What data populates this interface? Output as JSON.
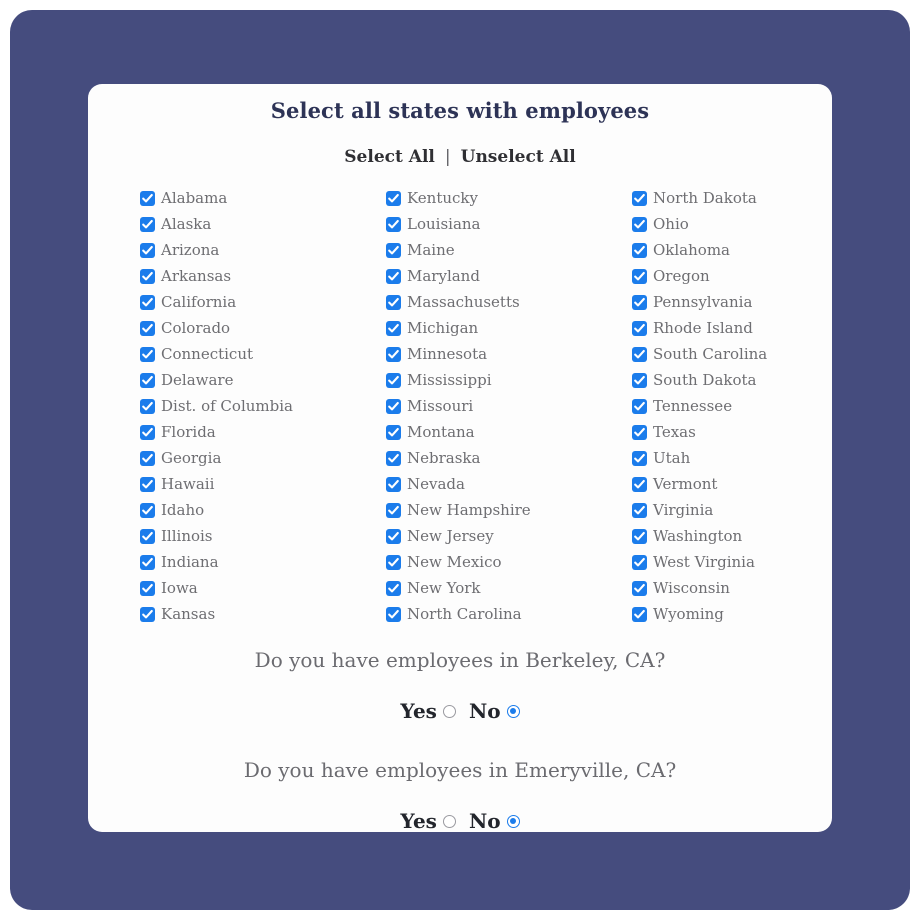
{
  "theme": {
    "page_background": "#ffffff",
    "viewport_background": "#454c7e",
    "card_background": "#fdfdfd",
    "title_color": "#2d3356",
    "label_color": "#6e6e72",
    "accent_blue": "#1b7ceb"
  },
  "form": {
    "title": "Select all states with employees",
    "bulk": {
      "select_all_label": "Select All",
      "separator": "|",
      "unselect_all_label": "Unselect All"
    },
    "columns": [
      {
        "items": [
          {
            "label": "Alabama",
            "checked": true
          },
          {
            "label": "Alaska",
            "checked": true
          },
          {
            "label": "Arizona",
            "checked": true
          },
          {
            "label": "Arkansas",
            "checked": true
          },
          {
            "label": "California",
            "checked": true
          },
          {
            "label": "Colorado",
            "checked": true
          },
          {
            "label": "Connecticut",
            "checked": true
          },
          {
            "label": "Delaware",
            "checked": true
          },
          {
            "label": "Dist. of Columbia",
            "checked": true
          },
          {
            "label": "Florida",
            "checked": true
          },
          {
            "label": "Georgia",
            "checked": true
          },
          {
            "label": "Hawaii",
            "checked": true
          },
          {
            "label": "Idaho",
            "checked": true
          },
          {
            "label": "Illinois",
            "checked": true
          },
          {
            "label": "Indiana",
            "checked": true
          },
          {
            "label": "Iowa",
            "checked": true
          },
          {
            "label": "Kansas",
            "checked": true
          }
        ]
      },
      {
        "items": [
          {
            "label": "Kentucky",
            "checked": true
          },
          {
            "label": "Louisiana",
            "checked": true
          },
          {
            "label": "Maine",
            "checked": true
          },
          {
            "label": "Maryland",
            "checked": true
          },
          {
            "label": "Massachusetts",
            "checked": true
          },
          {
            "label": "Michigan",
            "checked": true
          },
          {
            "label": "Minnesota",
            "checked": true
          },
          {
            "label": "Mississippi",
            "checked": true
          },
          {
            "label": "Missouri",
            "checked": true
          },
          {
            "label": "Montana",
            "checked": true
          },
          {
            "label": "Nebraska",
            "checked": true
          },
          {
            "label": "Nevada",
            "checked": true
          },
          {
            "label": "New Hampshire",
            "checked": true
          },
          {
            "label": "New Jersey",
            "checked": true
          },
          {
            "label": "New Mexico",
            "checked": true
          },
          {
            "label": "New York",
            "checked": true
          },
          {
            "label": "North Carolina",
            "checked": true
          }
        ]
      },
      {
        "items": [
          {
            "label": "North Dakota",
            "checked": true
          },
          {
            "label": "Ohio",
            "checked": true
          },
          {
            "label": "Oklahoma",
            "checked": true
          },
          {
            "label": "Oregon",
            "checked": true
          },
          {
            "label": "Pennsylvania",
            "checked": true
          },
          {
            "label": "Rhode Island",
            "checked": true
          },
          {
            "label": "South Carolina",
            "checked": true
          },
          {
            "label": "South Dakota",
            "checked": true
          },
          {
            "label": "Tennessee",
            "checked": true
          },
          {
            "label": "Texas",
            "checked": true
          },
          {
            "label": "Utah",
            "checked": true
          },
          {
            "label": "Vermont",
            "checked": true
          },
          {
            "label": "Virginia",
            "checked": true
          },
          {
            "label": "Washington",
            "checked": true
          },
          {
            "label": "West Virginia",
            "checked": true
          },
          {
            "label": "Wisconsin",
            "checked": true
          },
          {
            "label": "Wyoming",
            "checked": true
          }
        ]
      }
    ],
    "questions": [
      {
        "text": "Do you have employees in Berkeley, CA?",
        "options": [
          {
            "label": "Yes",
            "selected": false
          },
          {
            "label": "No",
            "selected": true
          }
        ]
      },
      {
        "text": "Do you have employees in Emeryville, CA?",
        "options": [
          {
            "label": "Yes",
            "selected": false
          },
          {
            "label": "No",
            "selected": true
          }
        ]
      }
    ]
  }
}
